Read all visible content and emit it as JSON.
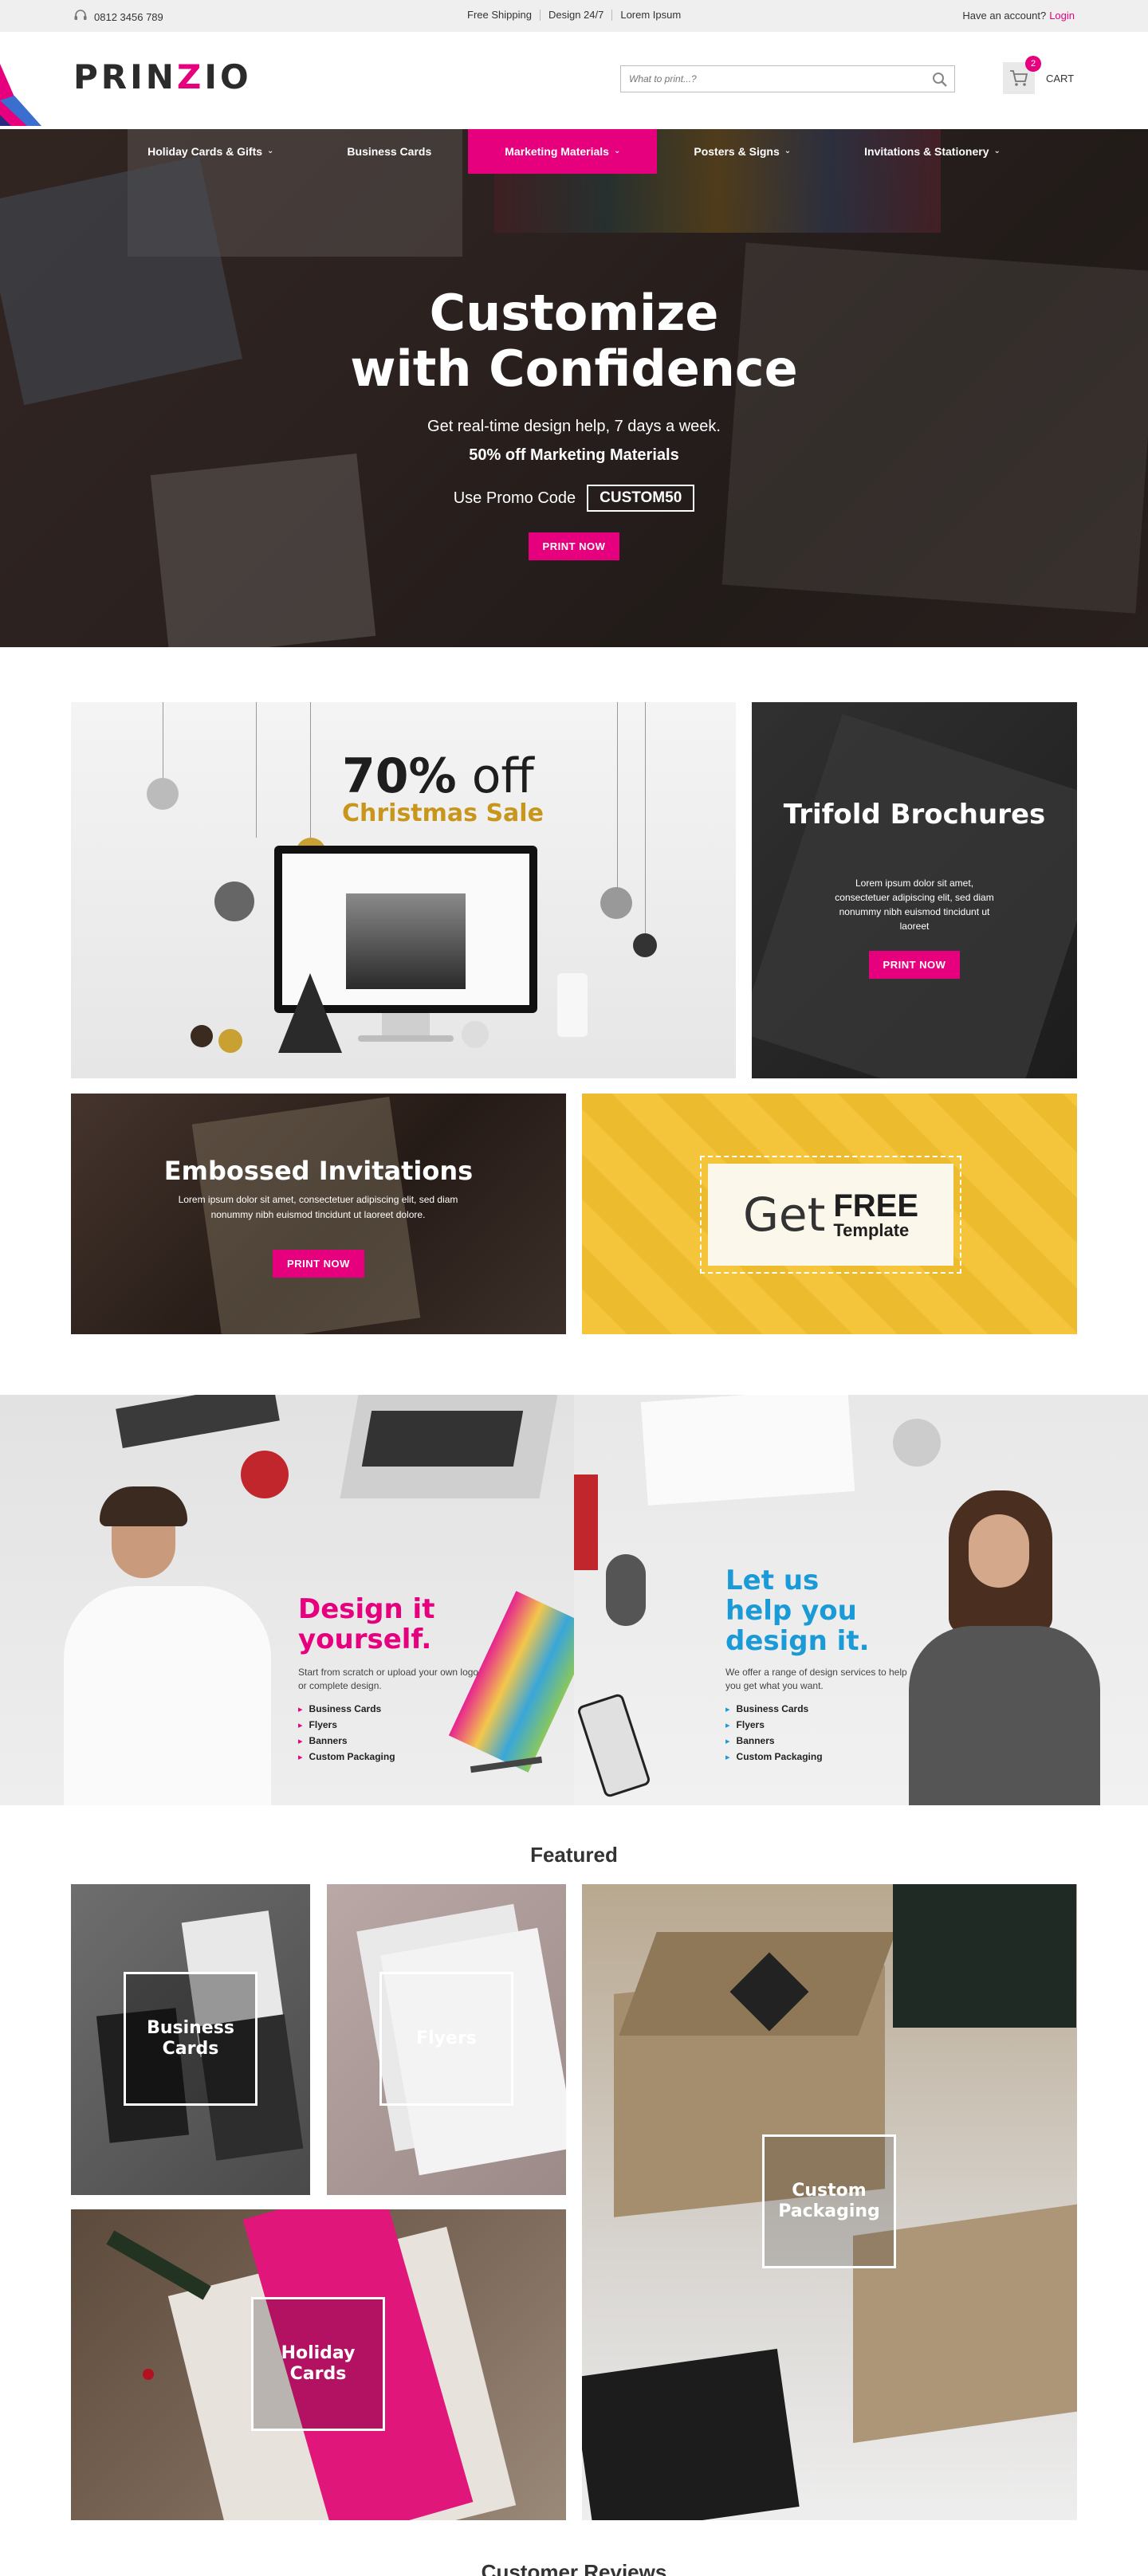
{
  "topbar": {
    "phone": "0812 3456 789",
    "links": [
      "Free Shipping",
      "Design 24/7",
      "Lorem Ipsum"
    ],
    "account_text": "Have an account?",
    "login_label": "Login"
  },
  "header": {
    "logo_pre": "PRIN",
    "logo_z": "Z",
    "logo_post": "IO",
    "search_placeholder": "What to print...?",
    "cart_count": "2",
    "cart_label": "CART"
  },
  "nav": {
    "items": [
      {
        "label": "Holiday Cards & Gifts",
        "has_menu": true
      },
      {
        "label": "Business Cards",
        "has_menu": false
      },
      {
        "label": "Marketing Materials",
        "has_menu": true
      },
      {
        "label": "Posters & Signs",
        "has_menu": true
      },
      {
        "label": "Invitations & Stationery",
        "has_menu": true
      }
    ]
  },
  "hero": {
    "title_line1": "Customize",
    "title_line2": "with Confidence",
    "subtitle": "Get real-time design help, 7 days a week.",
    "offer": "50% off Marketing Materials",
    "promo_label": "Use Promo Code",
    "promo_code": "CUSTOM50",
    "cta": "PRINT NOW"
  },
  "promos": {
    "xmas": {
      "pct": "70%",
      "off": " off",
      "sale": "Christmas Sale"
    },
    "trifold": {
      "title": "Trifold Brochures",
      "desc": "Lorem ipsum dolor sit amet, consectetuer adipiscing elit, sed diam nonummy nibh euismod tincidunt ut laoreet",
      "cta": "PRINT NOW"
    },
    "embossed": {
      "title": "Embossed Invitations",
      "desc": "Lorem ipsum dolor sit amet, consectetuer adipiscing elit, sed diam nonummy nibh euismod tincidunt ut laoreet dolore.",
      "cta": "PRINT NOW"
    },
    "free": {
      "get": "Get",
      "free": "FREE",
      "template": "Template"
    }
  },
  "design_yourself": {
    "title_line1": "Design it",
    "title_line2": "yourself.",
    "desc": "Start from scratch or upload your own logo or complete design.",
    "items": [
      "Business Cards",
      "Flyers",
      "Banners",
      "Custom Packaging"
    ]
  },
  "design_help": {
    "title_line1": "Let us",
    "title_line2": "help you",
    "title_line3": "design it.",
    "desc": "We offer a range of design services to help you get what you want.",
    "items": [
      "Business Cards",
      "Flyers",
      "Banners",
      "Custom Packaging"
    ]
  },
  "featured": {
    "title": "Featured",
    "tiles": [
      {
        "label_line1": "Business",
        "label_line2": "Cards"
      },
      {
        "label_line1": "Flyers",
        "label_line2": ""
      },
      {
        "label_line1": "Custom",
        "label_line2": "Packaging"
      },
      {
        "label_line1": "Holiday",
        "label_line2": "Cards"
      }
    ]
  },
  "reviews": {
    "title": "Customer Reviews"
  },
  "colors": {
    "accent": "#e6007e",
    "blue": "#1a9ad6",
    "gold": "#c7961b",
    "yellow": "#f4c12f"
  }
}
